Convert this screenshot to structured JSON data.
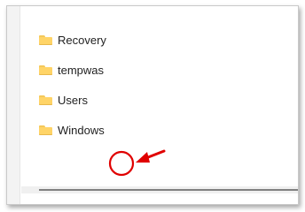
{
  "folders": [
    {
      "name": "Recovery",
      "icon": "folder-icon"
    },
    {
      "name": "tempwas",
      "icon": "folder-icon"
    },
    {
      "name": "Users",
      "icon": "folder-icon"
    },
    {
      "name": "Windows",
      "icon": "folder-icon"
    }
  ],
  "annotation": {
    "marker": "circle",
    "pointer": "arrow",
    "color": "#e00000"
  }
}
